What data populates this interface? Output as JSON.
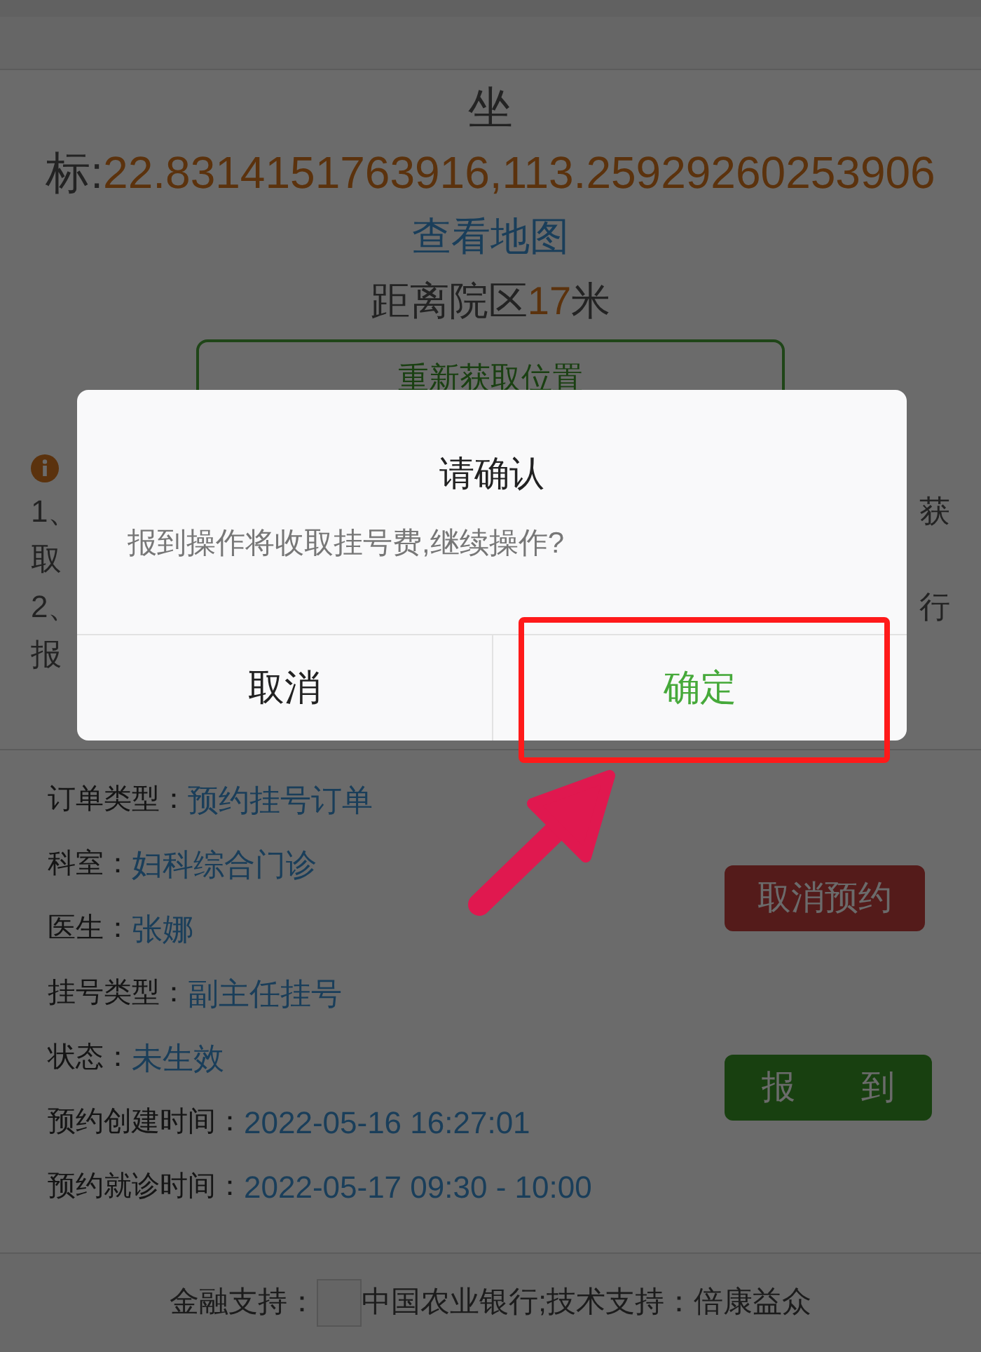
{
  "location": {
    "coordinates_label": "坐标:",
    "coordinates_value": "22.8314151763916,113.25929260253906",
    "map_link": "查看地图",
    "distance_prefix": "距离院区",
    "distance_value": "17",
    "distance_unit": "米",
    "relocate_button": "重新获取位置"
  },
  "notice_fragments": [
    {
      "left": "1、",
      "right": "获"
    },
    {
      "left": "取"
    },
    {
      "left": "2、",
      "right": "行"
    },
    {
      "left": "报"
    }
  ],
  "order": {
    "fields": [
      {
        "label": "订单类型：",
        "value": "预约挂号订单"
      },
      {
        "label": "科室：",
        "value": "妇科综合门诊"
      },
      {
        "label": "医生：",
        "value": "张娜"
      },
      {
        "label": "挂号类型：",
        "value": "副主任挂号"
      },
      {
        "label": "状态：",
        "value": "未生效"
      },
      {
        "label": "预约创建时间：",
        "value": "2022-05-16 16:27:01"
      },
      {
        "label": "预约就诊时间：",
        "value": "2022-05-17 09:30 - 10:00"
      }
    ],
    "actions": [
      {
        "label": "取消预约",
        "kind": "cancel"
      },
      {
        "label": "报 到",
        "kind": "checkin"
      }
    ]
  },
  "footer": {
    "finance_label": "金融支持：",
    "text": "中国农业银行;技术支持：倍康益众"
  },
  "dialog": {
    "title": "请确认",
    "message": "报到操作将收取挂号费,继续操作?",
    "buttons": [
      {
        "label": "取消",
        "highlighted": false
      },
      {
        "label": "确定",
        "highlighted": true
      }
    ]
  }
}
